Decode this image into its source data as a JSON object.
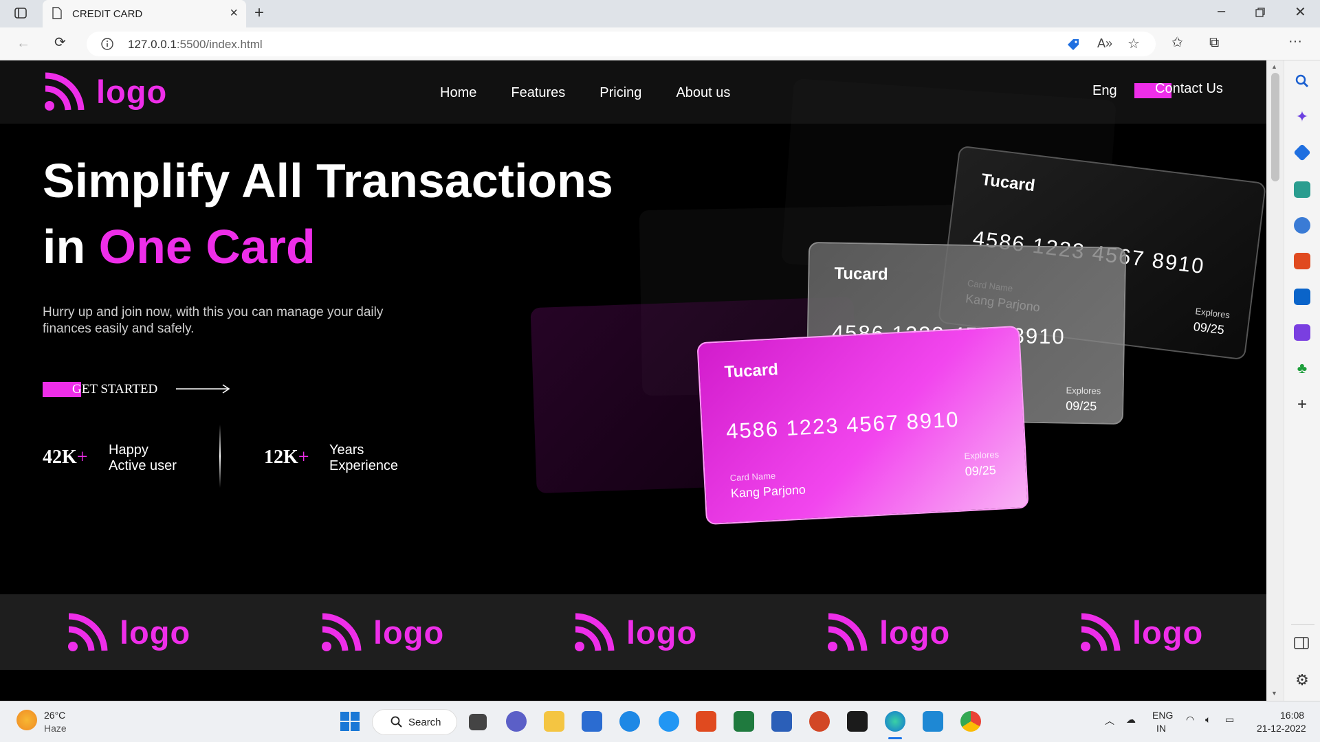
{
  "browser": {
    "tab_title": "CREDIT CARD",
    "url_host": "127.0.0.1",
    "url_rest": ":5500/index.html"
  },
  "nav": {
    "logo_text": "logo",
    "links": [
      "Home",
      "Features",
      "Pricing",
      "About us"
    ],
    "lang": "Eng",
    "contact": "Contact Us"
  },
  "hero": {
    "title_line1": "Simplify All Transactions",
    "title_line2_prefix": "in ",
    "title_line2_accent": "One Card",
    "subtitle": "Hurry up and join now, with this you can manage your daily finances easily and safely.",
    "cta": "GET STARTED",
    "stats": [
      {
        "number": "42K",
        "plus": "+",
        "label1": "Happy",
        "label2": "Active user"
      },
      {
        "number": "12K",
        "plus": "+",
        "label1": "Years",
        "label2": "Experience"
      }
    ]
  },
  "card": {
    "brand": "Tucard",
    "number": "4586 1223 4567 8910",
    "name_label": "Card Name",
    "name": "Kang Parjono",
    "exp_label": "Explores",
    "exp": "09/25"
  },
  "strip": {
    "logos": [
      "logo",
      "logo",
      "logo",
      "logo",
      "logo"
    ]
  },
  "taskbar": {
    "weather_temp": "26°C",
    "weather_desc": "Haze",
    "search": "Search",
    "lang1": "ENG",
    "lang2": "IN",
    "time": "16:08",
    "date": "21-12-2022"
  },
  "colors": {
    "accent": "#ee2ee9"
  }
}
